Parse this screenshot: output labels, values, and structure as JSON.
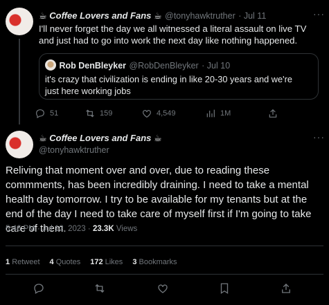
{
  "first_tweet": {
    "display_name": "☕ Coffee Lovers and Fans ☕",
    "handle": "@tonyhawktruther",
    "date": "· Jul 11",
    "text": "I'll never forget the day we all witnessed a literal assault on live TV and just had to go into work the next day like nothing happened.",
    "quote": {
      "display_name": "Rob DenBleyker",
      "handle": "@RobDenBleyker",
      "date": "· Jul 10",
      "text": "it's crazy that civilization is ending in like 20-30 years and we're just here working jobs"
    },
    "actions": {
      "replies": "51",
      "retweets": "159",
      "likes": "4,549",
      "views": "1M"
    }
  },
  "main_tweet": {
    "display_name": "☕ Coffee Lovers and Fans ☕",
    "handle": "@tonyhawktruther",
    "text": "Reliving that moment over and over, due to reading these commments, has been incredibly draining. I need to take a mental health day tomorrow. I try to be available for my tenants but at the end of the day I need to take care of myself first if I'm going to take care of them.",
    "timestamp": "5:46 PM · Jul 12, 2023 ·",
    "views_count": "23.3K",
    "views_label": "Views",
    "stats": {
      "retweets_count": "1",
      "retweets_label": "Retweet",
      "quotes_count": "4",
      "quotes_label": "Quotes",
      "likes_count": "172",
      "likes_label": "Likes",
      "bookmarks_count": "3",
      "bookmarks_label": "Bookmarks"
    }
  },
  "icons": [
    "reply-icon",
    "retweet-icon",
    "like-icon",
    "views-icon",
    "share-icon",
    "bookmark-icon",
    "more-icon"
  ]
}
